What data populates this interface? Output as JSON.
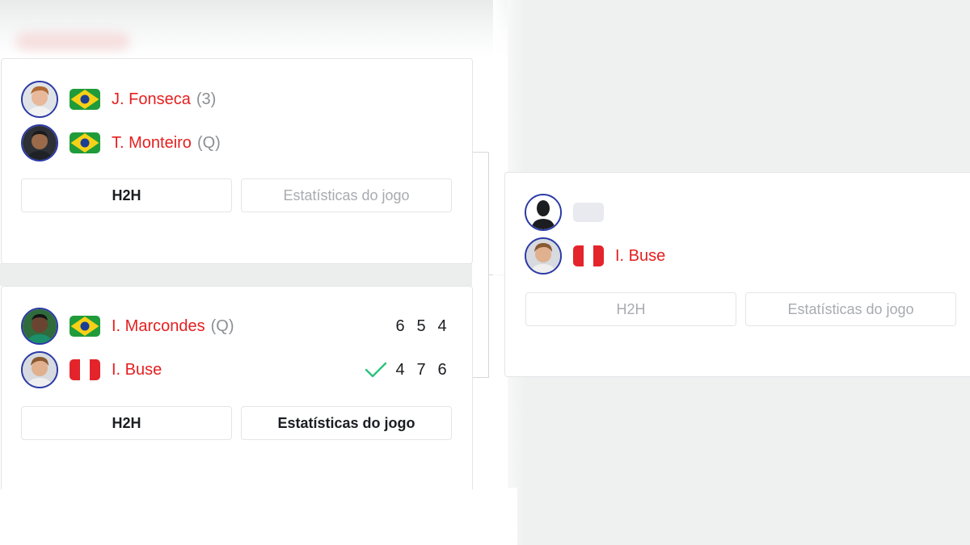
{
  "matches": [
    {
      "players": [
        {
          "name": "J. Fonseca",
          "seed": "(3)",
          "flag": "Brazil",
          "avatar": "player-avatar"
        },
        {
          "name": "T. Monteiro",
          "seed": "(Q)",
          "flag": "Brazil",
          "avatar": "player-avatar"
        }
      ],
      "buttons": {
        "h2h": "H2H",
        "stats": "Estatísticas do jogo"
      }
    },
    {
      "players": [
        {
          "name": "I. Marcondes",
          "seed": "(Q)",
          "flag": "Brazil",
          "scores": [
            "6",
            "5",
            "4"
          ]
        },
        {
          "name": "I. Buse",
          "seed": "",
          "flag": "Peru",
          "scores": [
            "4",
            "7",
            "6"
          ],
          "winner": true
        }
      ],
      "buttons": {
        "h2h": "H2H",
        "stats": "Estatísticas do jogo"
      }
    },
    {
      "players": [
        {
          "name": "",
          "flag": "",
          "avatar": "placeholder-silhouette"
        },
        {
          "name": "I. Buse",
          "seed": "",
          "flag": "Peru"
        }
      ],
      "buttons": {
        "h2h": "H2H",
        "stats": "Estatísticas do jogo"
      }
    }
  ],
  "colors": {
    "player_name": "#e51f1f",
    "seed": "#8c8f93",
    "winner_check": "#2ec27e",
    "avatar_ring": "#2b3aa6"
  }
}
